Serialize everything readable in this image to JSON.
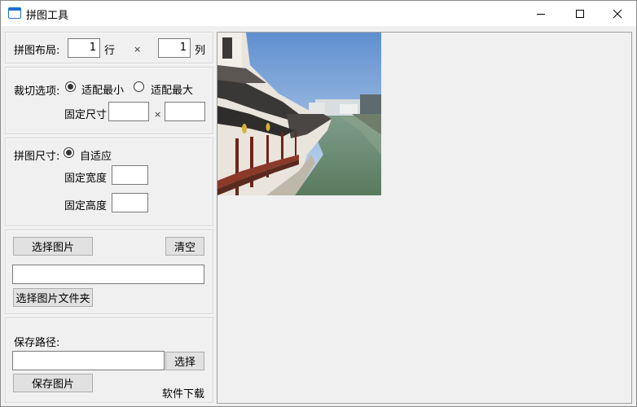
{
  "window": {
    "title": "拼图工具"
  },
  "layout_section": {
    "label": "拼图布局:",
    "rows_value": "1",
    "rows_unit": "行",
    "times": "×",
    "cols_value": "1",
    "cols_unit": "列"
  },
  "crop_section": {
    "label": "裁切选项:",
    "option_min": "适配最小",
    "option_max": "适配最大",
    "selected": "适配最小",
    "fixed_size_label": "固定尺寸",
    "width_value": "",
    "times": "×",
    "height_value": ""
  },
  "size_section": {
    "label": "拼图尺寸:",
    "option_auto": "自适应",
    "fixed_width_label": "固定宽度",
    "fixed_width_value": "",
    "fixed_height_label": "固定高度",
    "fixed_height_value": ""
  },
  "images_section": {
    "select_images_label": "选择图片",
    "clear_label": "清空",
    "path_value": "",
    "select_folder_label": "选择图片文件夹"
  },
  "save_section": {
    "save_path_label": "保存路径:",
    "save_path_value": "",
    "browse_label": "选择",
    "save_image_label": "保存图片",
    "download_link": "软件下载"
  },
  "preview": {
    "image_subject": "canal-town-photo"
  }
}
